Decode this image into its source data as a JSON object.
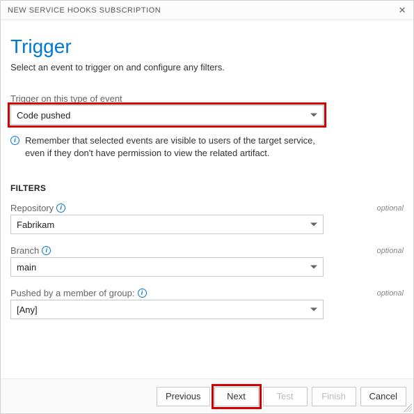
{
  "titlebar": {
    "title": "NEW SERVICE HOOKS SUBSCRIPTION"
  },
  "header": {
    "title": "Trigger",
    "subtitle": "Select an event to trigger on and configure any filters."
  },
  "event": {
    "label": "Trigger on this type of event",
    "value": "Code pushed",
    "note": "Remember that selected events are visible to users of the target service, even if they don't have permission to view the related artifact."
  },
  "filters": {
    "heading": "FILTERS",
    "repository": {
      "label": "Repository",
      "optional": "optional",
      "value": "Fabrikam"
    },
    "branch": {
      "label": "Branch",
      "optional": "optional",
      "value": "main"
    },
    "group": {
      "label": "Pushed by a member of group:",
      "optional": "optional",
      "value": "[Any]"
    }
  },
  "buttons": {
    "previous": "Previous",
    "next": "Next",
    "test": "Test",
    "finish": "Finish",
    "cancel": "Cancel"
  }
}
